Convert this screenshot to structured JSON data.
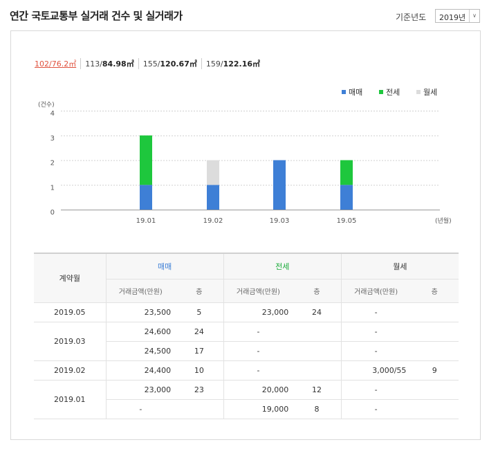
{
  "header": {
    "title": "연간 국토교통부 실거래 건수 및 실거래가",
    "year_label": "기준년도",
    "year_value": "2019년"
  },
  "area_tabs": [
    {
      "prefix": "102/",
      "value": "76.2㎡",
      "selected": true
    },
    {
      "prefix": "113/",
      "value": "84.98㎡",
      "selected": false
    },
    {
      "prefix": "155/",
      "value": "120.67㎡",
      "selected": false
    },
    {
      "prefix": "159/",
      "value": "122.16㎡",
      "selected": false
    }
  ],
  "colors": {
    "maemae": "#3e7fd6",
    "jeonse": "#1ec73d",
    "wolse": "#dcdcdc",
    "selected_tab": "#e0503c"
  },
  "chart_data": {
    "type": "bar",
    "stacked": true,
    "categories": [
      "19.01",
      "19.02",
      "19.03",
      "19.05"
    ],
    "series": [
      {
        "name": "매매",
        "values": [
          1,
          1,
          2,
          1
        ]
      },
      {
        "name": "전세",
        "values": [
          2,
          0,
          0,
          1
        ]
      },
      {
        "name": "월세",
        "values": [
          0,
          1,
          0,
          0
        ]
      }
    ],
    "ylabel": "(건수)",
    "xlabel": "(년월)",
    "ylim": [
      0,
      4
    ],
    "yticks": [
      0,
      1,
      2,
      3,
      4
    ],
    "grid": true,
    "legend": "top-right"
  },
  "table": {
    "col_contract": "계약월",
    "groups": [
      "매매",
      "전세",
      "월세"
    ],
    "sub_amount": "거래금액(만원)",
    "sub_floor": "층",
    "rows": [
      {
        "month": "2019.05",
        "lines": [
          [
            "23,500",
            "5",
            "23,000",
            "24",
            "-",
            ""
          ]
        ]
      },
      {
        "month": "2019.03",
        "lines": [
          [
            "24,600",
            "24",
            "-",
            "",
            "-",
            ""
          ],
          [
            "24,500",
            "17",
            "-",
            "",
            "-",
            ""
          ]
        ]
      },
      {
        "month": "2019.02",
        "lines": [
          [
            "24,400",
            "10",
            "-",
            "",
            "3,000/55",
            "9"
          ]
        ]
      },
      {
        "month": "2019.01",
        "lines": [
          [
            "23,000",
            "23",
            "20,000",
            "12",
            "-",
            ""
          ],
          [
            "-",
            "",
            "19,000",
            "8",
            "-",
            ""
          ]
        ]
      }
    ]
  }
}
